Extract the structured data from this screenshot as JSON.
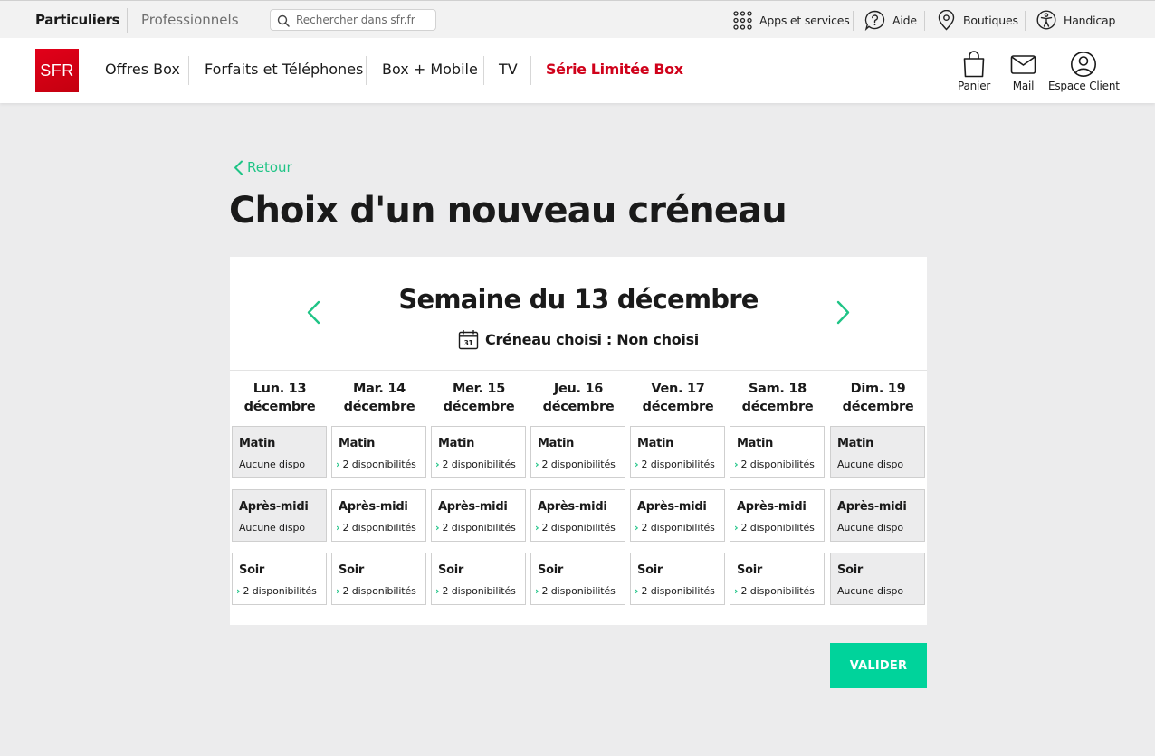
{
  "topbar": {
    "segment_particuliers": "Particuliers",
    "segment_professionnels": "Professionnels",
    "search_placeholder": "Rechercher dans sfr.fr",
    "apps_label": "Apps et services",
    "help_label": "Aide",
    "shops_label": "Boutiques",
    "handicap_label": "Handicap"
  },
  "nav": {
    "logo": "SFR",
    "items": [
      "Offres Box",
      "Forfaits et Téléphones",
      "Box + Mobile",
      "TV",
      "Série Limitée Box"
    ],
    "cart_label": "Panier",
    "mail_label": "Mail",
    "account_label": "Espace Client"
  },
  "page": {
    "back_label": "Retour",
    "title": "Choix d'un nouveau créneau",
    "week_title": "Semaine du 13 décembre",
    "calendar_day": "31",
    "chosen_label": "Créneau choisi : Non choisi",
    "validate_label": "VALIDER"
  },
  "days": [
    {
      "name": "Lun. 13",
      "month": "décembre"
    },
    {
      "name": "Mar. 14",
      "month": "décembre"
    },
    {
      "name": "Mer. 15",
      "month": "décembre"
    },
    {
      "name": "Jeu. 16",
      "month": "décembre"
    },
    {
      "name": "Ven. 17",
      "month": "décembre"
    },
    {
      "name": "Sam. 18",
      "month": "décembre"
    },
    {
      "name": "Dim. 19",
      "month": "décembre"
    }
  ],
  "slot_rows": [
    {
      "label": "Matin",
      "availability": [
        "Aucune dispo",
        "2 disponibilités",
        "2 disponibilités",
        "2 disponibilités",
        "2 disponibilités",
        "2 disponibilités",
        "Aucune dispo"
      ]
    },
    {
      "label": "Après-midi",
      "availability": [
        "Aucune dispo",
        "2 disponibilités",
        "2 disponibilités",
        "2 disponibilités",
        "2 disponibilités",
        "2 disponibilités",
        "Aucune dispo"
      ]
    },
    {
      "label": "Soir",
      "availability": [
        "2 disponibilités",
        "2 disponibilités",
        "2 disponibilités",
        "2 disponibilités",
        "2 disponibilités",
        "2 disponibilités",
        "Aucune dispo"
      ]
    }
  ],
  "colors": {
    "brand_red": "#e2001a",
    "accent_green": "#1fc486",
    "validate_green": "#00d39b",
    "special_red": "#d0021b"
  }
}
